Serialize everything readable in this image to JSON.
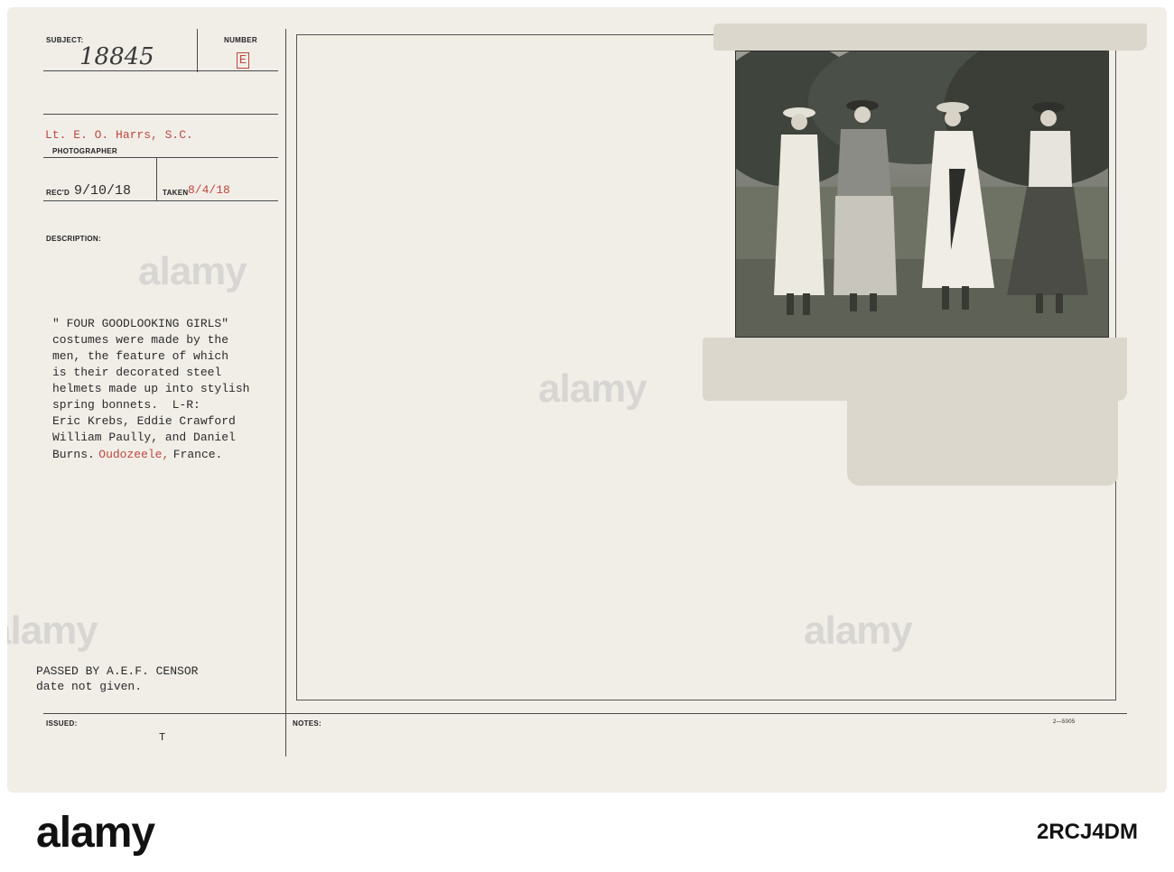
{
  "card": {
    "subject_label": "SUBJECT:",
    "subject_value": "18845",
    "number_label": "NUMBER",
    "number_value": "E",
    "photographer_name": "Lt. E. O. Harrs, S.C.",
    "photographer_label": "PHOTOGRAPHER",
    "recd_label": "REC'D",
    "recd_value": "9/10/18",
    "taken_label": "TAKEN",
    "taken_value": "8/4/18",
    "description_label": "DESCRIPTION:",
    "description_lines": [
      "\" FOUR GOODLOOKING GIRLS\"",
      "costumes were made by the",
      "men, the feature of which",
      "is their decorated steel",
      "helmets made up into stylish",
      "spring bonnets.  L-R:",
      "Eric Krebs, Eddie Crawford",
      "William Paully, and Daniel",
      "Burns."
    ],
    "place_name": "Oudozeele,",
    "country": "France.",
    "censor_line1": "PASSED BY A.E.F. CENSOR",
    "censor_line2": "date not given.",
    "issued_label": "ISSUED:",
    "issued_value": "T",
    "notes_label": "NOTES:",
    "form_code": "2—5005"
  },
  "watermark": {
    "text": "alamy"
  },
  "footer": {
    "logo": "alamy",
    "image_id": "2RCJ4DM"
  },
  "colors": {
    "card_bg": "#f1eee8",
    "red_type": "#c0473f",
    "rule": "#4a4a4a"
  }
}
